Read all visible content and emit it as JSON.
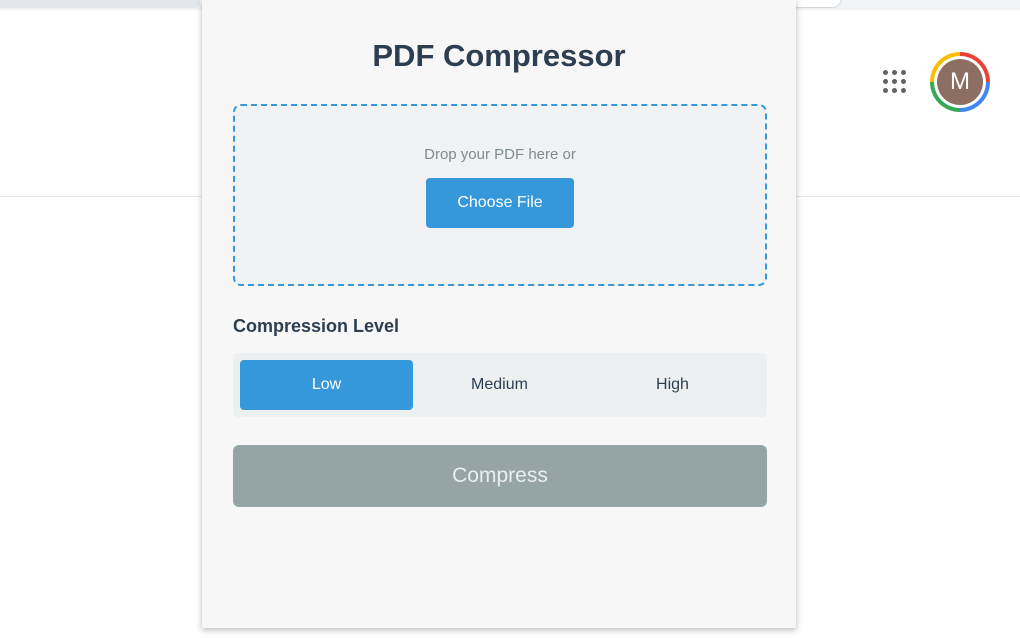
{
  "browser": {
    "apps_icon": "apps-grid-icon",
    "avatar_initial": "M",
    "avatar_color": "#8d6e63"
  },
  "popup": {
    "title": "PDF Compressor",
    "dropzone": {
      "text": "Drop your PDF here or",
      "button_label": "Choose File"
    },
    "compression": {
      "label": "Compression Level",
      "options": [
        "Low",
        "Medium",
        "High"
      ],
      "selected": "Low"
    },
    "compress_button_label": "Compress"
  },
  "colors": {
    "accent": "#3498db",
    "title": "#2c3e50",
    "disabled_button": "#95a5a6"
  }
}
